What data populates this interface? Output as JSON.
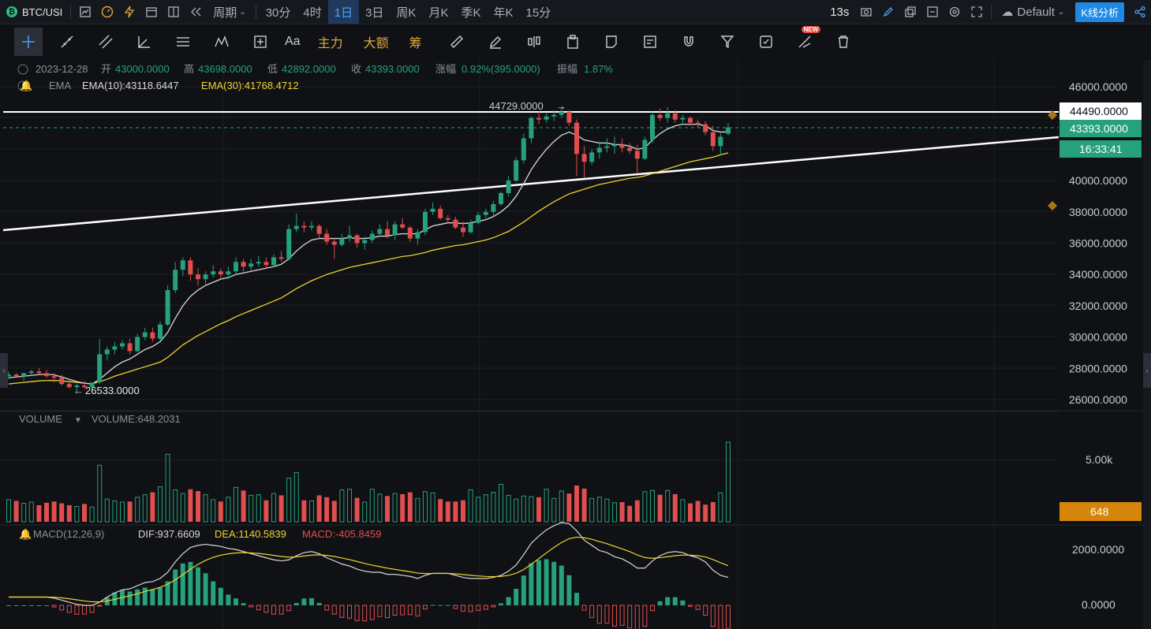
{
  "topbar": {
    "symbol": "BTC/USI",
    "period_label": "周期",
    "intervals": [
      "30分",
      "4时",
      "1日",
      "3日",
      "周K",
      "月K",
      "季K",
      "年K",
      "15分"
    ],
    "active_interval": "1日",
    "refresh": "13s",
    "theme": "Default",
    "kline_button": "K线分析"
  },
  "toolbar": {
    "zhuli": "主力",
    "dae": "大额",
    "chou": "筹",
    "text_tool": "Aa",
    "new_badge": "NEW"
  },
  "ohlc": {
    "date": "2023-12-28",
    "open_label": "开",
    "open": "43000.0000",
    "high_label": "高",
    "high": "43698.0000",
    "low_label": "低",
    "low": "42892.0000",
    "close_label": "收",
    "close": "43393.0000",
    "change_label": "涨幅",
    "change": "0.92%(395.0000)",
    "amp_label": "振幅",
    "amp": "1.87%"
  },
  "ema": {
    "name": "EMA",
    "ema10": "EMA(10):43118.6447",
    "ema30": "EMA(30):41768.4712"
  },
  "volume": {
    "name": "VOLUME",
    "value": "VOLUME:648.2031",
    "axis_label": "5.00k",
    "last": "648"
  },
  "macd": {
    "name": "MACD(12,26,9)",
    "dif": "DIF:937.6609",
    "dea": "DEA:1140.5839",
    "macd": "MACD:-405.8459",
    "axis_top": "2000.0000",
    "axis_zero": "0.0000"
  },
  "price_axis": [
    "46000.0000",
    "44000.0000",
    "42000.0000",
    "40000.0000",
    "38000.0000",
    "36000.0000",
    "34000.0000",
    "32000.0000",
    "30000.0000",
    "28000.0000",
    "26000.0000"
  ],
  "price_tags": {
    "hline": "44490.0000",
    "last": "43393.0000",
    "countdown": "16:33:41"
  },
  "annotations": {
    "high": "44729.0000",
    "low": "26533.0000"
  },
  "colors": {
    "up": "#26a17b",
    "down": "#e04e4e",
    "ema10": "#d8d8d8",
    "ema30": "#f0d22e",
    "accent": "#1e88e5",
    "volume_tag": "#d4850a"
  },
  "chart_data": {
    "type": "candlestick",
    "candles": [
      [
        27500,
        27800,
        27300,
        27600
      ],
      [
        27600,
        27700,
        27400,
        27500
      ],
      [
        27500,
        27600,
        27200,
        27700
      ],
      [
        27700,
        27900,
        27500,
        27800
      ],
      [
        27800,
        28000,
        27600,
        27700
      ],
      [
        27700,
        27900,
        27400,
        27500
      ],
      [
        27500,
        27700,
        27100,
        27400
      ],
      [
        27400,
        27600,
        26900,
        27000
      ],
      [
        27000,
        27300,
        26700,
        26800
      ],
      [
        26800,
        27000,
        26533,
        26900
      ],
      [
        26900,
        27200,
        26700,
        26800
      ],
      [
        26800,
        27000,
        26600,
        27100
      ],
      [
        27100,
        29900,
        27000,
        28900
      ],
      [
        28900,
        29400,
        28500,
        29200
      ],
      [
        29200,
        29700,
        28900,
        29400
      ],
      [
        29400,
        29800,
        29200,
        29600
      ],
      [
        29600,
        29900,
        28900,
        29100
      ],
      [
        29100,
        30200,
        29000,
        30000
      ],
      [
        30000,
        30600,
        29800,
        30300
      ],
      [
        30300,
        30600,
        29700,
        29900
      ],
      [
        29900,
        31000,
        29800,
        30800
      ],
      [
        30800,
        33300,
        30700,
        33000
      ],
      [
        33000,
        34800,
        32800,
        34300
      ],
      [
        34300,
        35100,
        33900,
        34900
      ],
      [
        34900,
        35100,
        33600,
        34000
      ],
      [
        34000,
        34400,
        33300,
        33700
      ],
      [
        33700,
        34200,
        33400,
        34000
      ],
      [
        34000,
        34600,
        33800,
        34200
      ],
      [
        34200,
        34400,
        33700,
        34000
      ],
      [
        34000,
        34500,
        33700,
        34200
      ],
      [
        34200,
        35100,
        34000,
        34800
      ],
      [
        34800,
        35000,
        34200,
        34500
      ],
      [
        34500,
        35000,
        34200,
        34700
      ],
      [
        34700,
        35200,
        34500,
        34800
      ],
      [
        34800,
        35100,
        34400,
        34600
      ],
      [
        34600,
        35300,
        34500,
        35100
      ],
      [
        35100,
        35500,
        34800,
        35000
      ],
      [
        35000,
        37200,
        34900,
        36900
      ],
      [
        36900,
        37900,
        36700,
        37100
      ],
      [
        37100,
        37400,
        36700,
        37000
      ],
      [
        37000,
        37400,
        36800,
        37100
      ],
      [
        37100,
        37200,
        36300,
        36600
      ],
      [
        36600,
        36900,
        35900,
        36100
      ],
      [
        36100,
        36300,
        35000,
        35900
      ],
      [
        35900,
        36600,
        35800,
        36300
      ],
      [
        36300,
        37100,
        36100,
        36500
      ],
      [
        36500,
        36600,
        35700,
        36000
      ],
      [
        36000,
        36400,
        35600,
        36200
      ],
      [
        36200,
        36800,
        36000,
        36600
      ],
      [
        36600,
        37200,
        36400,
        36900
      ],
      [
        36900,
        37400,
        36300,
        36500
      ],
      [
        36500,
        37400,
        36200,
        37200
      ],
      [
        37200,
        37600,
        36900,
        37000
      ],
      [
        37000,
        37100,
        36100,
        36300
      ],
      [
        36300,
        36900,
        35900,
        36700
      ],
      [
        36700,
        38200,
        36500,
        38000
      ],
      [
        38000,
        38600,
        37800,
        38200
      ],
      [
        38200,
        38400,
        37500,
        37600
      ],
      [
        37600,
        37800,
        37300,
        37500
      ],
      [
        37500,
        37700,
        36900,
        37000
      ],
      [
        37000,
        37400,
        36400,
        36700
      ],
      [
        36700,
        37500,
        36600,
        37300
      ],
      [
        37300,
        38000,
        37200,
        37800
      ],
      [
        37800,
        38200,
        37600,
        38000
      ],
      [
        38000,
        38700,
        37700,
        38500
      ],
      [
        38500,
        39300,
        38400,
        39200
      ],
      [
        39200,
        40300,
        39000,
        40000
      ],
      [
        40000,
        41500,
        39900,
        41300
      ],
      [
        41300,
        43000,
        41100,
        42700
      ],
      [
        42700,
        44100,
        42400,
        44000
      ],
      [
        44000,
        44400,
        43600,
        43900
      ],
      [
        43900,
        44300,
        43700,
        44100
      ],
      [
        44100,
        44500,
        43800,
        44200
      ],
      [
        44200,
        44729,
        44000,
        44400
      ],
      [
        44400,
        44500,
        43500,
        43700
      ],
      [
        43700,
        43900,
        40300,
        41700
      ],
      [
        41700,
        42200,
        40200,
        41200
      ],
      [
        41200,
        42000,
        41000,
        41800
      ],
      [
        41800,
        42500,
        41400,
        42100
      ],
      [
        42100,
        42700,
        41800,
        42200
      ],
      [
        42200,
        42800,
        41700,
        42300
      ],
      [
        42300,
        42700,
        41800,
        42100
      ],
      [
        42100,
        42400,
        41700,
        41900
      ],
      [
        41900,
        42300,
        40500,
        41400
      ],
      [
        41400,
        42800,
        41300,
        42600
      ],
      [
        42600,
        44400,
        42400,
        44200
      ],
      [
        44200,
        44600,
        43800,
        44000
      ],
      [
        44000,
        44700,
        43700,
        44300
      ],
      [
        44300,
        44500,
        43700,
        43900
      ],
      [
        43900,
        44200,
        43600,
        44000
      ],
      [
        44000,
        44100,
        43500,
        43700
      ],
      [
        43700,
        43900,
        43400,
        43600
      ],
      [
        43600,
        43800,
        42900,
        43100
      ],
      [
        43100,
        43500,
        41900,
        42200
      ],
      [
        42200,
        43000,
        41600,
        42800
      ],
      [
        43000,
        43698,
        42892,
        43393
      ]
    ],
    "volumes": [
      180,
      170,
      150,
      160,
      135,
      155,
      165,
      150,
      135,
      125,
      145,
      120,
      460,
      185,
      170,
      160,
      165,
      200,
      220,
      240,
      285,
      550,
      260,
      230,
      265,
      250,
      220,
      180,
      165,
      200,
      280,
      255,
      215,
      220,
      175,
      230,
      215,
      355,
      400,
      175,
      170,
      215,
      200,
      170,
      260,
      265,
      195,
      160,
      265,
      225,
      210,
      230,
      225,
      240,
      190,
      245,
      235,
      185,
      165,
      165,
      175,
      260,
      200,
      220,
      240,
      305,
      215,
      185,
      210,
      205,
      200,
      265,
      190,
      250,
      230,
      295,
      270,
      190,
      200,
      185,
      155,
      160,
      130,
      175,
      245,
      255,
      220,
      255,
      225,
      180,
      150,
      170,
      140,
      160,
      235,
      648
    ],
    "ema10": [
      27400,
      27450,
      27500,
      27550,
      27600,
      27620,
      27580,
      27450,
      27300,
      27150,
      27050,
      27000,
      27300,
      27700,
      28100,
      28400,
      28600,
      28900,
      29200,
      29400,
      29700,
      30300,
      31200,
      32000,
      32600,
      33000,
      33300,
      33500,
      33700,
      33800,
      34000,
      34100,
      34200,
      34300,
      34400,
      34500,
      34650,
      35000,
      35500,
      35900,
      36200,
      36300,
      36300,
      36300,
      36300,
      36350,
      36300,
      36300,
      36350,
      36450,
      36450,
      36550,
      36600,
      36600,
      36600,
      36850,
      37100,
      37200,
      37300,
      37300,
      37250,
      37300,
      37400,
      37500,
      37700,
      38000,
      38400,
      39000,
      39800,
      40700,
      41400,
      42000,
      42500,
      42900,
      43100,
      42900,
      42600,
      42500,
      42400,
      42400,
      42300,
      42300,
      42200,
      42000,
      42100,
      42600,
      43000,
      43300,
      43500,
      43600,
      43600,
      43600,
      43500,
      43200,
      43100,
      43118
    ],
    "ema30": [
      27000,
      27050,
      27100,
      27150,
      27200,
      27220,
      27230,
      27200,
      27150,
      27100,
      27050,
      27000,
      27150,
      27300,
      27500,
      27650,
      27800,
      27950,
      28100,
      28250,
      28400,
      28700,
      29100,
      29500,
      29800,
      30100,
      30350,
      30600,
      30850,
      31050,
      31300,
      31500,
      31700,
      31900,
      32100,
      32300,
      32500,
      32800,
      33100,
      33350,
      33600,
      33800,
      34000,
      34150,
      34300,
      34450,
      34550,
      34650,
      34750,
      34850,
      34950,
      35050,
      35150,
      35200,
      35300,
      35400,
      35550,
      35650,
      35750,
      35850,
      35900,
      36000,
      36100,
      36200,
      36350,
      36550,
      36750,
      37050,
      37350,
      37700,
      38050,
      38350,
      38650,
      38900,
      39150,
      39300,
      39450,
      39600,
      39750,
      39850,
      39950,
      40050,
      40150,
      40200,
      40300,
      40450,
      40600,
      40750,
      40900,
      41050,
      41200,
      41300,
      41400,
      41500,
      41650,
      41768
    ]
  }
}
